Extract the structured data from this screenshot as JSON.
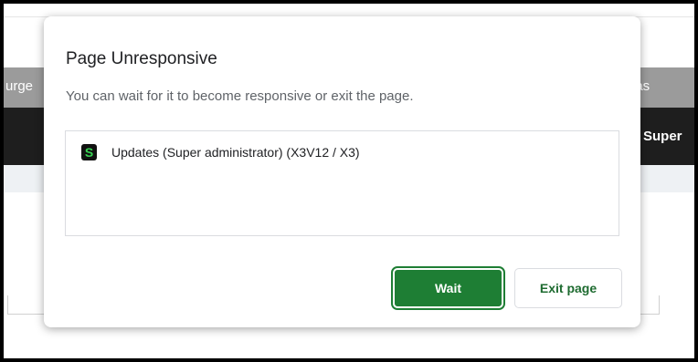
{
  "background": {
    "left_fragment": "urge",
    "right_fragment": "eas",
    "user_label": "Super"
  },
  "dialog": {
    "title": "Page Unresponsive",
    "message": "You can wait for it to become responsive or exit the page.",
    "pages": [
      {
        "icon": "green-s-app-icon",
        "icon_letter": "S",
        "label": "Updates (Super administrator) (X3V12 / X3)"
      }
    ],
    "buttons": {
      "wait_label": "Wait",
      "exit_label": "Exit page"
    }
  },
  "colors": {
    "primary_green": "#1e7e34",
    "exit_text_green": "#1e6b30",
    "favicon_green": "#39d353"
  }
}
